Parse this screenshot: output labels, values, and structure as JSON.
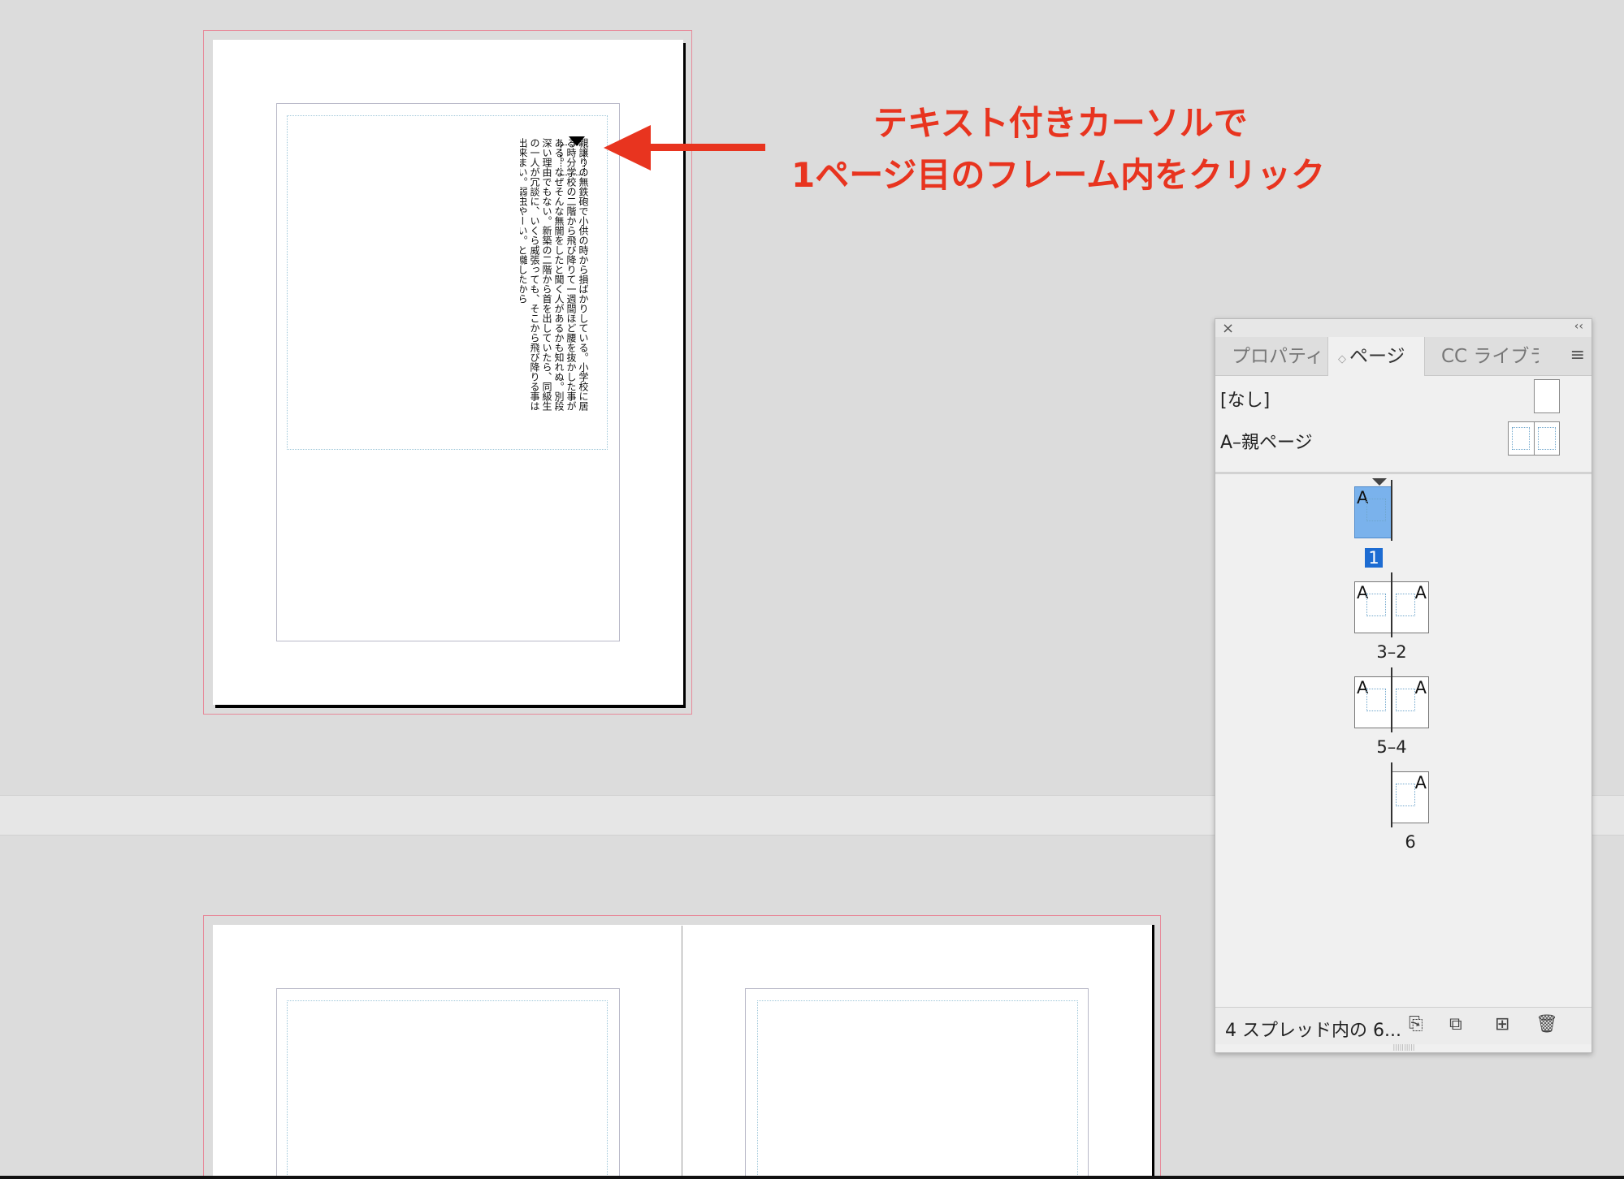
{
  "annotation": {
    "line1": "テキスト付きカーソルで",
    "line2": "1ページ目のフレーム内をクリック"
  },
  "document": {
    "vertical_text": "親譲りの無鉄砲で小供の時から損ばかりしている。小学校に居る時分学校の二階から飛び降りて一週間ほど腰を抜かした事がある。なぜそんな無闇をしたと聞く人があるかも知れぬ。別段深い理由でもない。新築の二階から首を出していたら、同級生の一人が冗談に、いくら威張っても、そこから飛び降りる事は出来まい。弱虫やーい。と囃したから"
  },
  "pages_panel": {
    "tabs": [
      {
        "label": "プロパティ"
      },
      {
        "label": "ページ"
      },
      {
        "label": "CC ライブラ"
      }
    ],
    "parents": [
      {
        "label": "[なし]"
      },
      {
        "label": "A–親ページ"
      }
    ],
    "pages": [
      {
        "label": "1",
        "letters": [
          "A"
        ]
      },
      {
        "label": "3–2",
        "letters": [
          "A",
          "A"
        ]
      },
      {
        "label": "5–4",
        "letters": [
          "A",
          "A"
        ]
      },
      {
        "label": "6",
        "letters": [
          "A"
        ]
      }
    ],
    "footer": {
      "status": "4 スプレッド内の 6..."
    }
  }
}
